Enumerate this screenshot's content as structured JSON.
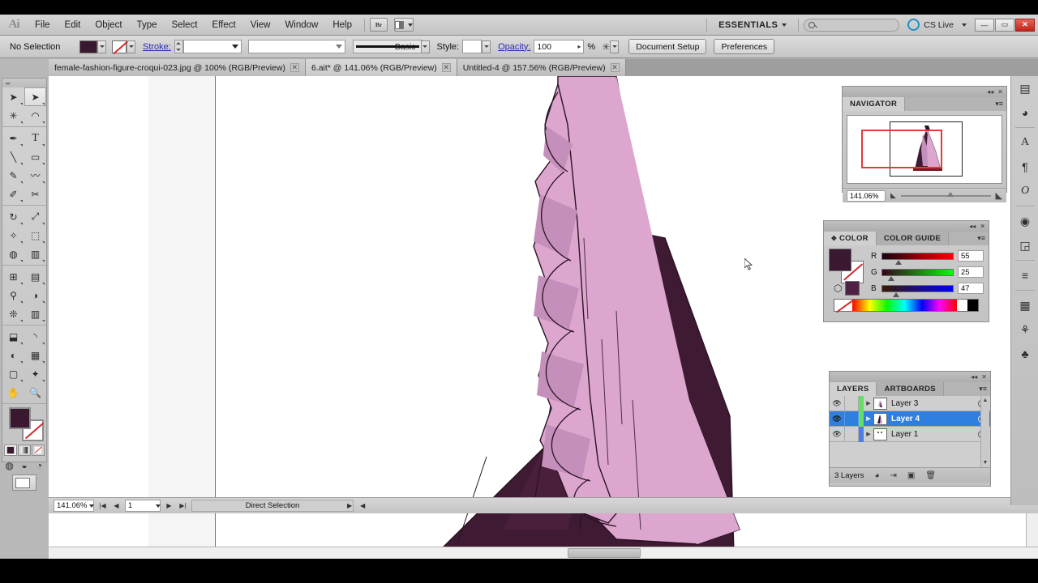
{
  "app": {
    "logo": "Ai",
    "menus": [
      "File",
      "Edit",
      "Object",
      "Type",
      "Select",
      "Effect",
      "View",
      "Window",
      "Help"
    ],
    "bridge_button": "Br",
    "workspace": "ESSENTIALS",
    "search_placeholder": "",
    "cs_live": "CS Live",
    "window_buttons": {
      "minimize": "—",
      "restore": "▭",
      "close": "✕"
    }
  },
  "control_bar": {
    "selection_status": "No Selection",
    "fill_color": "#3a1830",
    "stroke_swatch": "none",
    "stroke_label": "Stroke:",
    "stroke_weight": "",
    "stroke_profile": "",
    "brush_name": "Basic",
    "style_label": "Style:",
    "opacity_label": "Opacity:",
    "opacity_value": "100",
    "opacity_unit": "%",
    "document_setup_button": "Document Setup",
    "preferences_button": "Preferences"
  },
  "tabs": [
    {
      "label": "female-fashion-figure-croqui-023.jpg @ 100% (RGB/Preview)",
      "close": "✕",
      "active": false
    },
    {
      "label": "6.ait* @ 141.06% (RGB/Preview)",
      "close": "✕",
      "active": true
    },
    {
      "label": "Untitled-4 @ 157.56% (RGB/Preview)",
      "close": "✕",
      "active": false
    }
  ],
  "toolbox": {
    "tools": [
      {
        "name": "selection-tool",
        "glyph": "➤",
        "selected": false
      },
      {
        "name": "direct-selection-tool",
        "glyph": "➤",
        "selected": true
      },
      {
        "name": "magic-wand-tool",
        "glyph": "✳",
        "selected": false
      },
      {
        "name": "lasso-tool",
        "glyph": "◠",
        "selected": false
      },
      {
        "name": "pen-tool",
        "glyph": "✒",
        "selected": false
      },
      {
        "name": "type-tool",
        "glyph": "T",
        "selected": false
      },
      {
        "name": "line-segment-tool",
        "glyph": "╲",
        "selected": false
      },
      {
        "name": "rectangle-tool",
        "glyph": "▭",
        "selected": false
      },
      {
        "name": "paintbrush-tool",
        "glyph": "🖌",
        "selected": false
      },
      {
        "name": "blob-brush-tool",
        "glyph": "〰",
        "selected": false
      },
      {
        "name": "pencil-tool",
        "glyph": "✎",
        "selected": false
      },
      {
        "name": "scissors-tool",
        "glyph": "✂",
        "selected": false
      },
      {
        "name": "rotate-tool",
        "glyph": "↻",
        "selected": false
      },
      {
        "name": "scale-tool",
        "glyph": "⤢",
        "selected": false
      },
      {
        "name": "width-tool",
        "glyph": "✧",
        "selected": false
      },
      {
        "name": "free-transform-tool",
        "glyph": "⬚",
        "selected": false
      },
      {
        "name": "shape-builder-tool",
        "glyph": "◍",
        "selected": false
      },
      {
        "name": "perspective-grid-tool",
        "glyph": "⧉",
        "selected": false
      },
      {
        "name": "mesh-tool",
        "glyph": "⊞",
        "selected": false
      },
      {
        "name": "gradient-tool",
        "glyph": "▤",
        "selected": false
      },
      {
        "name": "eyedropper-tool",
        "glyph": "⚲",
        "selected": false
      },
      {
        "name": "blend-tool",
        "glyph": "◑",
        "selected": false
      },
      {
        "name": "symbol-sprayer-tool",
        "glyph": "❊",
        "selected": false
      },
      {
        "name": "column-graph-tool",
        "glyph": "▥",
        "selected": false
      },
      {
        "name": "artboard-tool",
        "glyph": "⬓",
        "selected": false
      },
      {
        "name": "slice-tool",
        "glyph": "◣",
        "selected": false
      },
      {
        "name": "eraser-tool",
        "glyph": "◐",
        "selected": false
      },
      {
        "name": "gradient-mesh-tool",
        "glyph": "▦",
        "selected": false
      },
      {
        "name": "zoom-frame-tool",
        "glyph": "▢",
        "selected": false
      },
      {
        "name": "magic-eraser-tool",
        "glyph": "✦",
        "selected": false
      },
      {
        "name": "hand-tool",
        "glyph": "✋",
        "selected": false
      },
      {
        "name": "zoom-tool",
        "glyph": "🔍",
        "selected": false
      }
    ],
    "fill_color": "#3a1830",
    "stroke_color": "none",
    "paint_modes": [
      "color-mode",
      "gradient-mode",
      "none-mode"
    ],
    "screen_mode": "normal-screen-mode"
  },
  "navigator": {
    "tab_label": "NAVIGATOR",
    "zoom_value": "141.06%"
  },
  "color_panel": {
    "tabs": [
      "COLOR",
      "COLOR GUIDE"
    ],
    "active_tab": "COLOR",
    "channels": [
      {
        "label": "R",
        "value": "55",
        "track_to": "#ff0000"
      },
      {
        "label": "G",
        "value": "25",
        "track_to": "#00ff00"
      },
      {
        "label": "B",
        "value": "47",
        "track_to": "#0000ff"
      }
    ],
    "fill_hex": "#3a1830",
    "secondary_swatch": "#4d2244"
  },
  "layers_panel": {
    "tabs": [
      "LAYERS",
      "ARTBOARDS"
    ],
    "active_tab": "LAYERS",
    "rows": [
      {
        "name": "Layer 3",
        "color": "#66dd66",
        "selected": false,
        "visible": true
      },
      {
        "name": "Layer 4",
        "color": "#66dd66",
        "selected": true,
        "visible": true
      },
      {
        "name": "Layer 1",
        "color": "#4d7fe0",
        "selected": false,
        "visible": true
      }
    ],
    "footer_count": "3 Layers",
    "footer_icons": [
      "make-clipping-mask",
      "make-sublayer",
      "new-layer",
      "delete-layer"
    ]
  },
  "status_bar": {
    "zoom_value": "141.06%",
    "page_value": "1",
    "tool_status": "Direct Selection"
  },
  "dock_icons": [
    "stroke-panel-icon",
    "transparency-panel-icon",
    "character-panel-icon",
    "paragraph-panel-icon",
    "opentype-panel-icon",
    "appearance-panel-icon",
    "graphic-styles-panel-icon",
    "align-panel-icon",
    "swatches-panel-icon",
    "brushes-panel-icon",
    "symbols-panel-icon"
  ],
  "artwork": {
    "light_pink": "#dca6cf",
    "mid_pink": "#c48fbb",
    "dark_plum": "#3f1a33",
    "mid_plum": "#50223f",
    "outline": "#2a1322"
  }
}
